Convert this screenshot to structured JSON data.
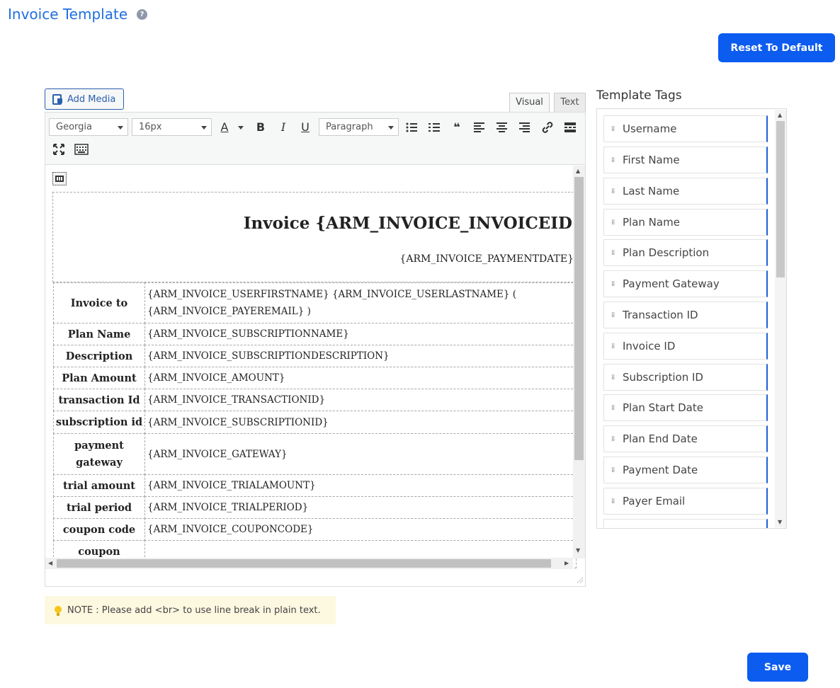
{
  "header": {
    "title": "Invoice Template",
    "help_icon": "?"
  },
  "buttons": {
    "reset": "Reset To Default",
    "save": "Save",
    "add_media": "Add Media"
  },
  "editor": {
    "tabs": {
      "visual": "Visual",
      "text": "Text"
    },
    "font_family": "Georgia",
    "font_size": "16px",
    "paragraph": "Paragraph",
    "toolbar_icons": [
      "text-color-icon",
      "bold-icon",
      "italic-icon",
      "underline-icon",
      "bullet-list-icon",
      "numbered-list-icon",
      "blockquote-icon",
      "align-left-icon",
      "align-center-icon",
      "align-right-icon",
      "link-icon",
      "read-more-icon",
      "fullscreen-icon",
      "keyboard-icon"
    ],
    "toolbar_glyphs": {
      "color": "A",
      "bold": "B",
      "italic": "I",
      "underline": "U",
      "quote": "❝",
      "link": "🔗"
    }
  },
  "invoice": {
    "title": "Invoice {ARM_INVOICE_INVOICEID",
    "date": "{ARM_INVOICE_PAYMENTDATE}",
    "rows": [
      {
        "label": "Invoice to",
        "value": "{ARM_INVOICE_USERFIRSTNAME} {ARM_INVOICE_USERLASTNAME} (",
        "value2": "{ARM_INVOICE_PAYEREMAIL} )"
      },
      {
        "label": "Plan Name",
        "value": "{ARM_INVOICE_SUBSCRIPTIONNAME}"
      },
      {
        "label": "Description",
        "value": "{ARM_INVOICE_SUBSCRIPTIONDESCRIPTION}"
      },
      {
        "label": "Plan Amount",
        "value": "{ARM_INVOICE_AMOUNT}"
      },
      {
        "label": "transaction Id",
        "value": "{ARM_INVOICE_TRANSACTIONID}"
      },
      {
        "label": "subscription id",
        "value": "{ARM_INVOICE_SUBSCRIPTIONID}"
      },
      {
        "label": "payment gateway",
        "value": "{ARM_INVOICE_GATEWAY}"
      },
      {
        "label": "trial amount",
        "value": "{ARM_INVOICE_TRIALAMOUNT}"
      },
      {
        "label": "trial period",
        "value": "{ARM_INVOICE_TRIALPERIOD}"
      },
      {
        "label": "coupon code",
        "value": "{ARM_INVOICE_COUPONCODE}"
      },
      {
        "label": "coupon",
        "value": ""
      }
    ]
  },
  "tags": {
    "title": "Template Tags",
    "items": [
      "Username",
      "First Name",
      "Last Name",
      "Plan Name",
      "Plan Description",
      "Payment Gateway",
      "Transaction ID",
      "Invoice ID",
      "Subscription ID",
      "Plan Start Date",
      "Plan End Date",
      "Payment Date",
      "Payer Email"
    ]
  },
  "note": "NOTE : Please add <br> to use line break in plain text."
}
